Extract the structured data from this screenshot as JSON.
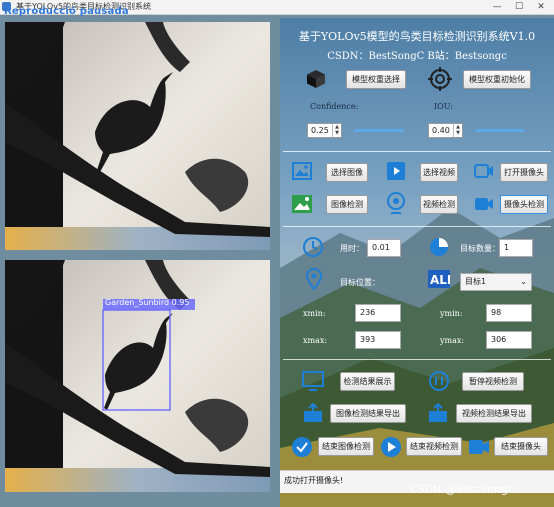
{
  "window": {
    "title": "基于YOLOv5的鸟类目标检测识别系统",
    "overlay_badge": "Reproducció pausada",
    "controls": [
      "—",
      "☐",
      "✕"
    ]
  },
  "header": {
    "title": "基于YOLOv5模型的鸟类目标检测识别系统V1.0",
    "subtitle": "CSDN：BestSongC   B站：Bestsongc"
  },
  "model": {
    "select_label": "模型权重选择",
    "init_label": "模型权重初始化"
  },
  "params": {
    "confidence_label": "Confidence:",
    "confidence_value": "0.25",
    "confidence_level": 0.25,
    "iou_label": "IOU:",
    "iou_value": "0.40",
    "iou_level": 0.4
  },
  "input": {
    "select_image": "选择图像",
    "select_video": "选择视频",
    "open_camera": "打开摄像头",
    "detect_image": "图像检测",
    "detect_video": "视频检测",
    "detect_camera": "摄像头检测"
  },
  "result": {
    "time_label": "用时：",
    "time_value": "0.01",
    "count_label": "目标数量：",
    "count_value": "1",
    "position_label": "目标位置：",
    "target_select": "目标1",
    "xmin_label": "xmin:",
    "xmin_value": "236",
    "ymin_label": "ymin:",
    "ymin_value": "98",
    "xmax_label": "xmax:",
    "xmax_value": "393",
    "ymax_label": "ymax:",
    "ymax_value": "306"
  },
  "actions": {
    "show_result": "检测结果展示",
    "pause_video": "暂停视频检测",
    "export_image": "图像检测结果导出",
    "export_video": "视频检测结果导出",
    "end_image": "结束图像检测",
    "end_video": "结束视频检测",
    "end_camera": "结束摄像头"
  },
  "detection": {
    "label": "Garden_Sunbird  0.95",
    "box_color": "#6b6bff"
  },
  "status": {
    "message": "成功打开摄像头!"
  },
  "watermark": "CSDN @BestSongC",
  "colors": {
    "accent": "#3b8de0",
    "icon_blue": "#2d86de"
  }
}
